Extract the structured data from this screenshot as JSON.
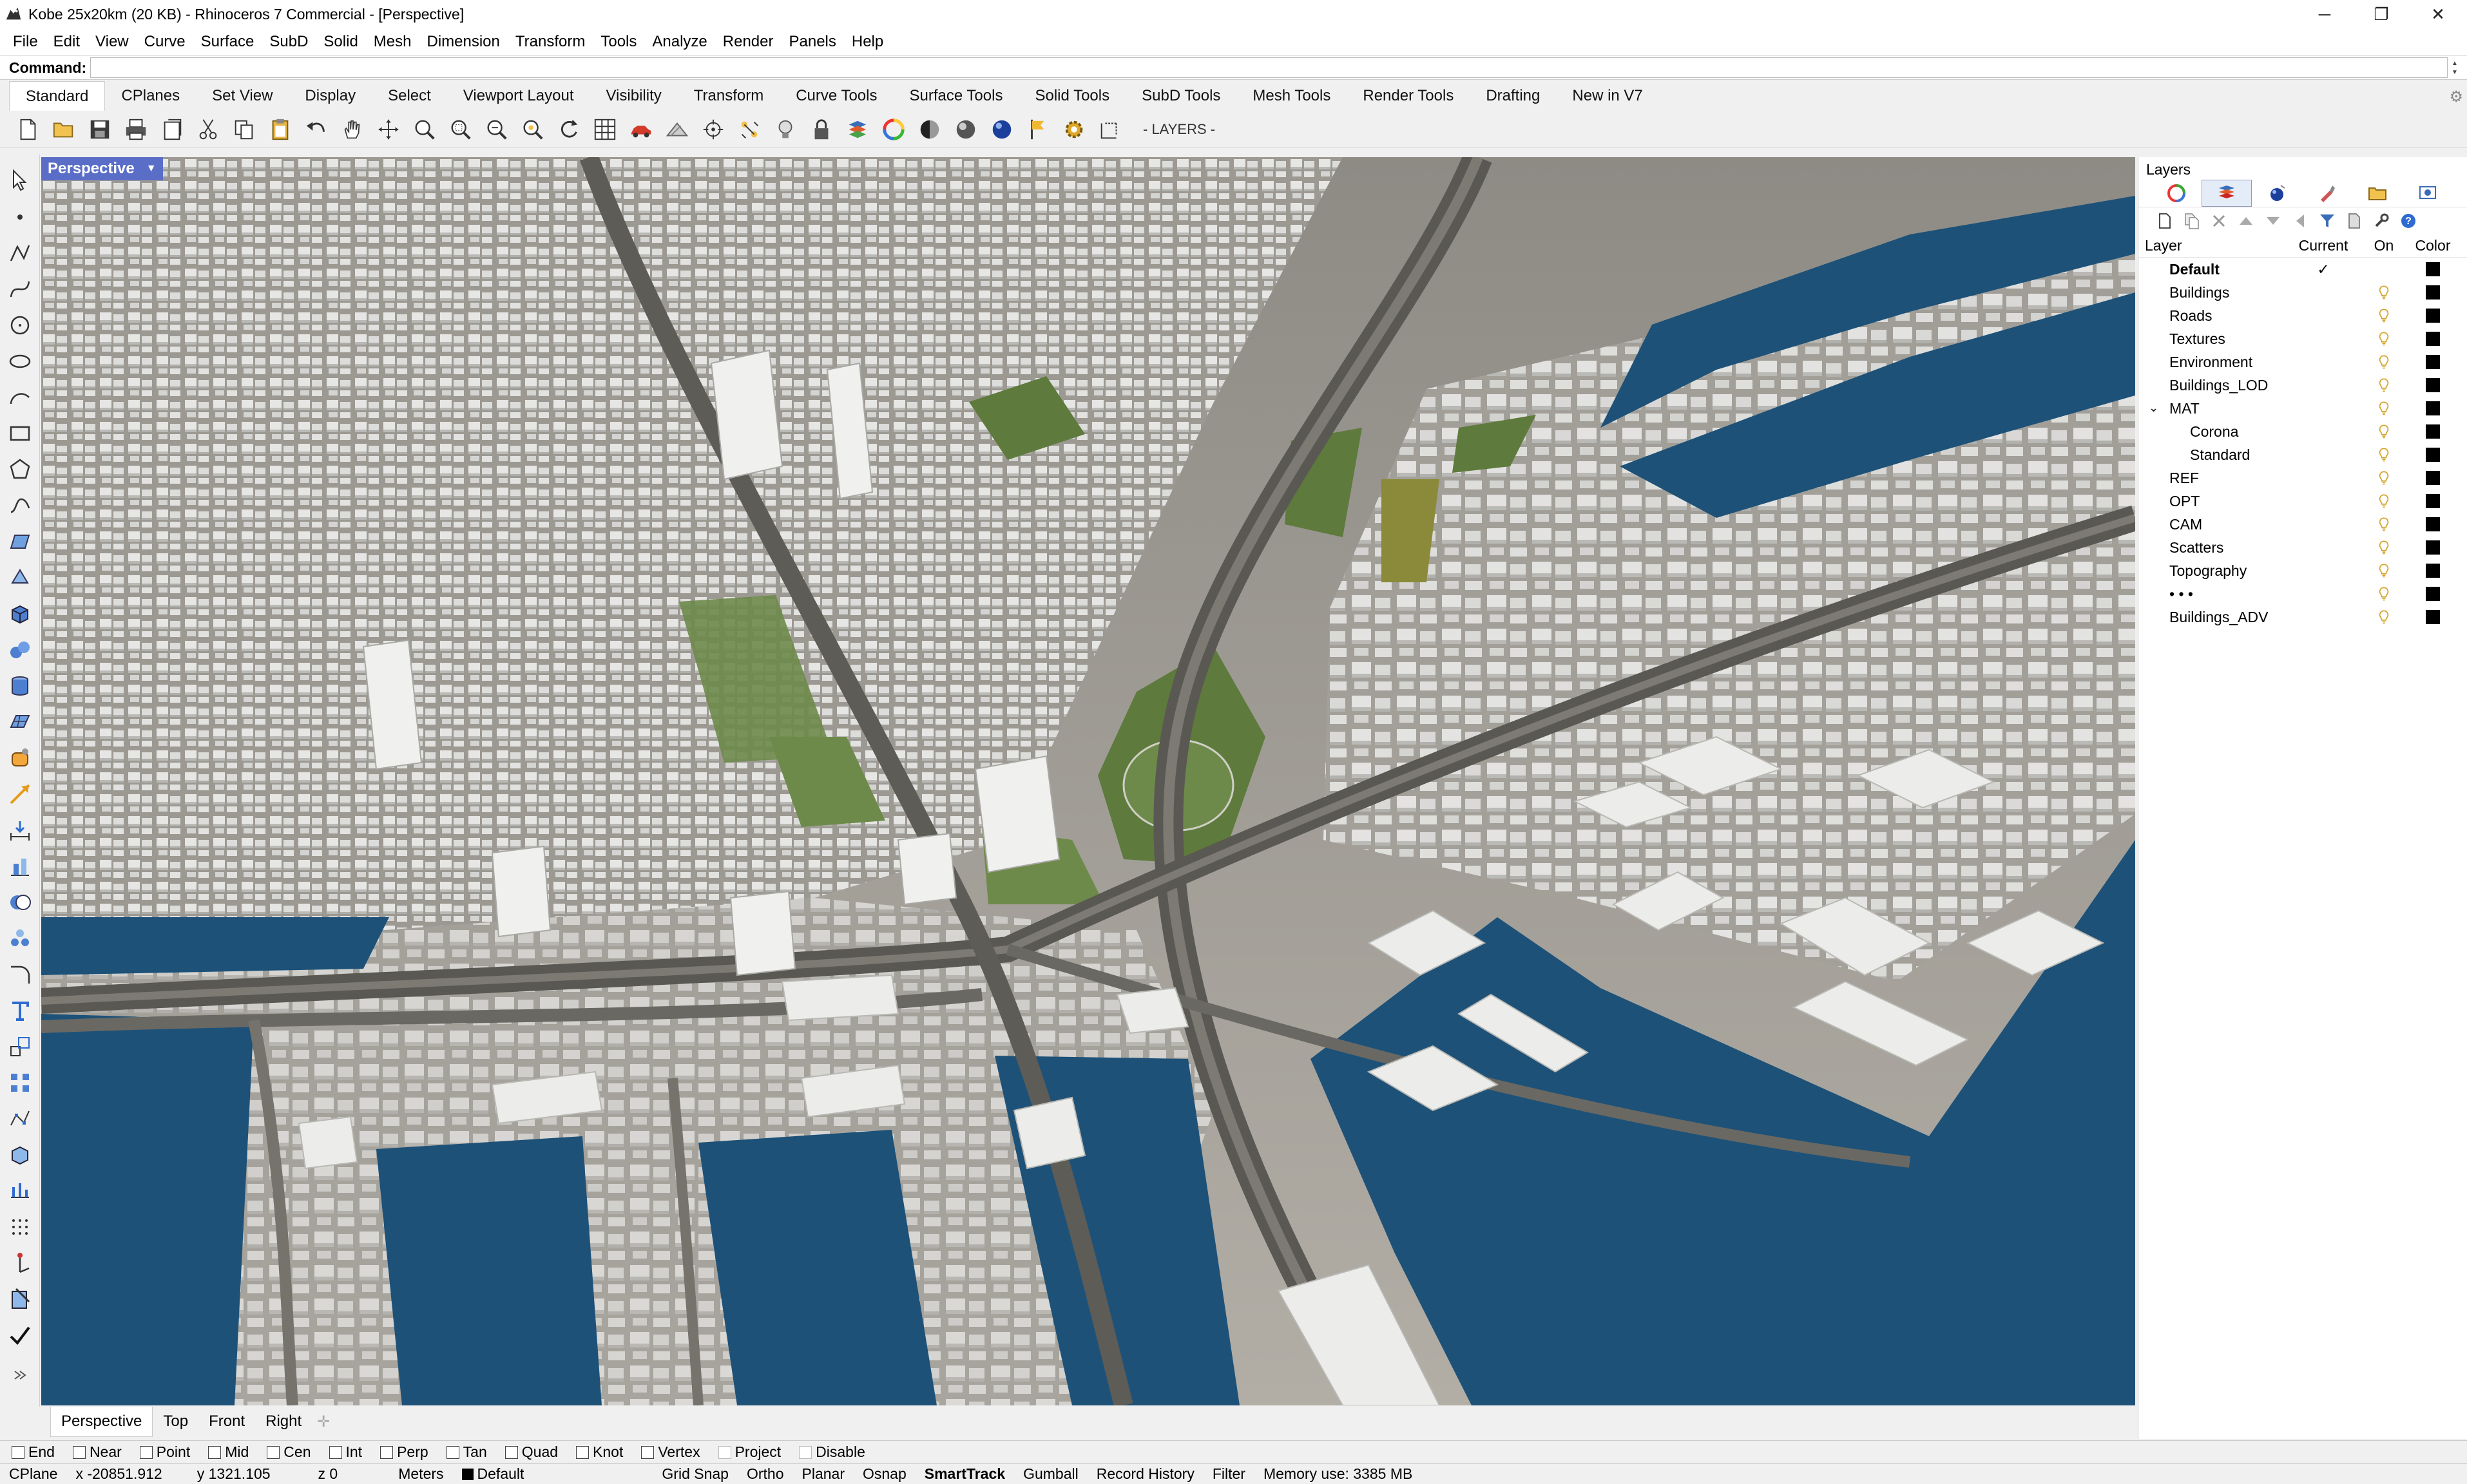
{
  "window": {
    "title": "Kobe 25x20km (20 KB) - Rhinoceros 7 Commercial - [Perspective]",
    "controls": [
      "─",
      "❐",
      "✕"
    ]
  },
  "menu": [
    "File",
    "Edit",
    "View",
    "Curve",
    "Surface",
    "SubD",
    "Solid",
    "Mesh",
    "Dimension",
    "Transform",
    "Tools",
    "Analyze",
    "Render",
    "Panels",
    "Help"
  ],
  "command": {
    "label": "Command:",
    "value": ""
  },
  "toolbar_tabs": [
    "Standard",
    "CPlanes",
    "Set View",
    "Display",
    "Select",
    "Viewport Layout",
    "Visibility",
    "Transform",
    "Curve Tools",
    "Surface Tools",
    "Solid Tools",
    "SubD Tools",
    "Mesh Tools",
    "Render Tools",
    "Drafting",
    "New in V7"
  ],
  "toolbar": {
    "icons": [
      "new-file-icon",
      "open-file-icon",
      "save-icon",
      "print-icon",
      "page-icon",
      "cut-icon",
      "copy-icon",
      "paste-icon",
      "undo-icon",
      "pan-hand-icon",
      "move-icon",
      "zoom-icon",
      "zoom-window-icon",
      "zoom-extents-icon",
      "zoom-selected-icon",
      "rotate-view-icon",
      "grid-icon",
      "car-icon",
      "shade-icon",
      "point-icon",
      "snap-icon",
      "light-icon",
      "lock-icon",
      "layer-icon",
      "color-wheel-icon",
      "sphere-grey-icon",
      "sphere-dark-icon",
      "sphere-blue-icon",
      "flag-icon",
      "settings-gear-icon",
      "dims-icon"
    ],
    "layers_label": "- LAYERS -"
  },
  "viewport": {
    "title": "Perspective"
  },
  "view_tabs": [
    "Perspective",
    "Top",
    "Front",
    "Right"
  ],
  "osnaps": [
    {
      "label": "End",
      "checked": false
    },
    {
      "label": "Near",
      "checked": false
    },
    {
      "label": "Point",
      "checked": false
    },
    {
      "label": "Mid",
      "checked": false
    },
    {
      "label": "Cen",
      "checked": false
    },
    {
      "label": "Int",
      "checked": false
    },
    {
      "label": "Perp",
      "checked": false
    },
    {
      "label": "Tan",
      "checked": false
    },
    {
      "label": "Quad",
      "checked": false
    },
    {
      "label": "Knot",
      "checked": false
    },
    {
      "label": "Vertex",
      "checked": false
    },
    {
      "label": "Project",
      "checked": false
    },
    {
      "label": "Disable",
      "checked": false
    }
  ],
  "status": {
    "cplane": "CPlane",
    "x": "x -20851.912",
    "y": "y 1321.105",
    "z": "z 0",
    "units": "Meters",
    "layer": "Default",
    "toggles": [
      {
        "label": "Grid Snap",
        "active": false
      },
      {
        "label": "Ortho",
        "active": false
      },
      {
        "label": "Planar",
        "active": false
      },
      {
        "label": "Osnap",
        "active": false
      },
      {
        "label": "SmartTrack",
        "active": true
      },
      {
        "label": "Gumball",
        "active": false
      },
      {
        "label": "Record History",
        "active": false
      },
      {
        "label": "Filter",
        "active": false
      }
    ],
    "memory": "Memory use: 3385 MB"
  },
  "layers_panel": {
    "title": "Layers",
    "columns": {
      "layer": "Layer",
      "current": "Current",
      "on": "On",
      "color": "Color"
    },
    "rows": [
      {
        "name": "Default",
        "current": "✓",
        "bulb": false,
        "color": "#000000",
        "indent": 0,
        "bold": true
      },
      {
        "name": "Buildings",
        "current": "",
        "bulb": true,
        "color": "#000000",
        "indent": 0
      },
      {
        "name": "Roads",
        "current": "",
        "bulb": true,
        "color": "#000000",
        "indent": 0
      },
      {
        "name": "Textures",
        "current": "",
        "bulb": true,
        "color": "#000000",
        "indent": 0
      },
      {
        "name": "Environment",
        "current": "",
        "bulb": true,
        "color": "#000000",
        "indent": 0
      },
      {
        "name": "Buildings_LOD",
        "current": "",
        "bulb": true,
        "color": "#000000",
        "indent": 0
      },
      {
        "name": "MAT",
        "current": "",
        "bulb": true,
        "color": "#000000",
        "indent": 0,
        "expanded": true
      },
      {
        "name": "Corona",
        "current": "",
        "bulb": true,
        "color": "#000000",
        "indent": 1
      },
      {
        "name": "Standard",
        "current": "",
        "bulb": true,
        "color": "#000000",
        "indent": 1
      },
      {
        "name": "REF",
        "current": "",
        "bulb": true,
        "color": "#000000",
        "indent": 0
      },
      {
        "name": "OPT",
        "current": "",
        "bulb": true,
        "color": "#000000",
        "indent": 0
      },
      {
        "name": "CAM",
        "current": "",
        "bulb": true,
        "color": "#000000",
        "indent": 0
      },
      {
        "name": "Scatters",
        "current": "",
        "bulb": true,
        "color": "#000000",
        "indent": 0
      },
      {
        "name": "Topography",
        "current": "",
        "bulb": true,
        "color": "#000000",
        "indent": 0
      },
      {
        "name": "• • •",
        "current": "",
        "bulb": true,
        "color": "#000000",
        "indent": 0
      },
      {
        "name": "Buildings_ADV",
        "current": "",
        "bulb": true,
        "color": "#000000",
        "indent": 0
      }
    ]
  },
  "colors": {
    "viewport_title_bg": "#5a6ec8",
    "water": "#1d5178",
    "land": "#a9a69f",
    "park": "#5e7a3c",
    "building": "#e4e4e2",
    "bulb": "#d4a52a"
  }
}
